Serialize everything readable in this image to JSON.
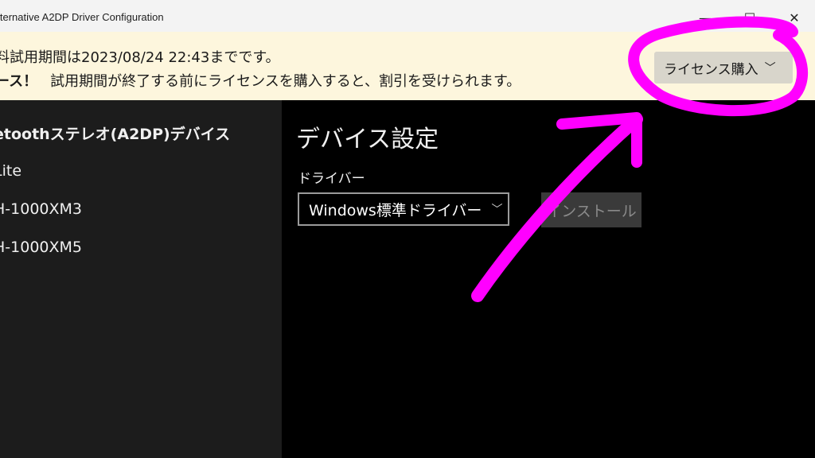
{
  "window": {
    "title": "lternative A2DP Driver Configuration",
    "controls": {
      "minimize": "—",
      "maximize": "☐",
      "close": "✕"
    }
  },
  "banner": {
    "line1": "料試用期間は2023/08/24 22:43までです。",
    "line2_bold": "ース！",
    "line2_text": "試用期間が終了する前にライセンスを購入すると、割引を受けられます。",
    "license_button": "ライセンス購入",
    "license_chevron": "﹀"
  },
  "sidebar": {
    "header": "etoothステレオ(A2DP)デバイス",
    "items": [
      {
        "label": "Lite"
      },
      {
        "label": "H-1000XM3"
      },
      {
        "label": "H-1000XM5"
      }
    ]
  },
  "main": {
    "title": "デバイス設定",
    "driver_label": "ドライバー",
    "driver_value": "Windows標準ドライバー",
    "driver_chevron": "﹀",
    "install_button": "インストール"
  },
  "annotation": {
    "color": "#ff00ff"
  }
}
